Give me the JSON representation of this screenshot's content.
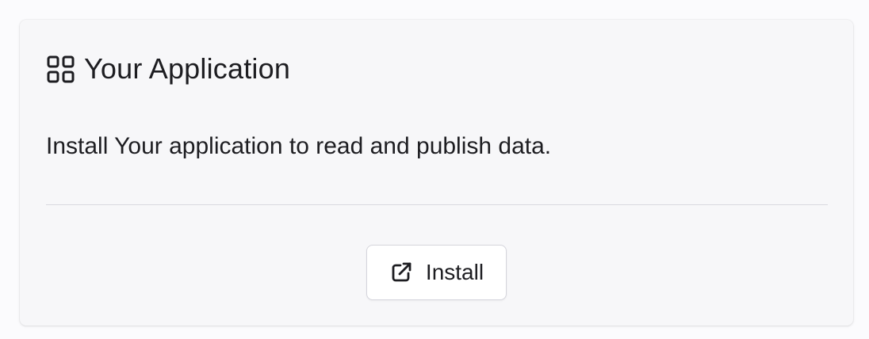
{
  "card": {
    "title": "Your Application",
    "title_icon": "grid-icon",
    "description": "Install Your application to read and publish data.",
    "install_button": {
      "label": "Install",
      "icon": "external-link-icon"
    }
  }
}
